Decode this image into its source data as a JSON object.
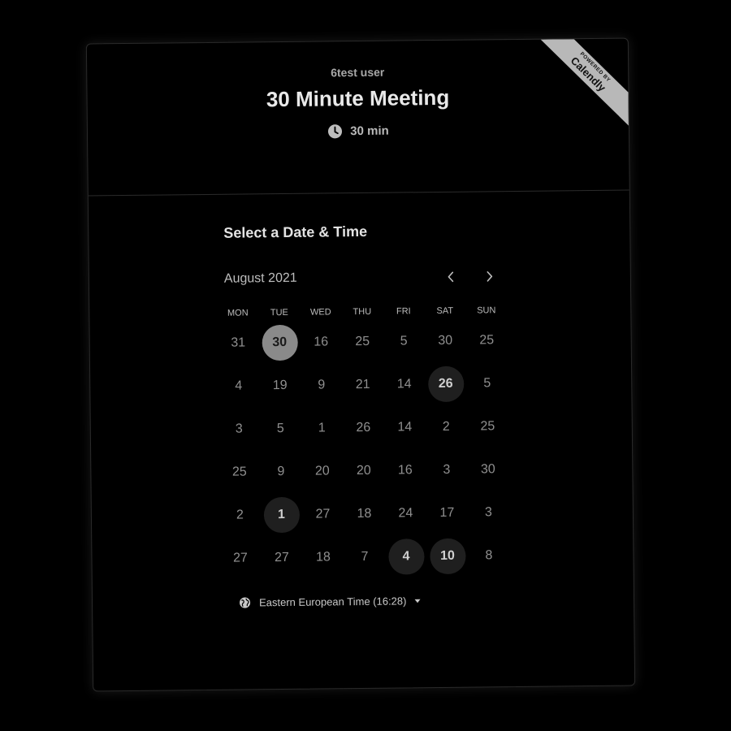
{
  "header": {
    "host_name": "6test user",
    "event_title": "30 Minute Meeting",
    "duration": "30 min"
  },
  "ribbon": {
    "small_text": "POWERED BY",
    "brand": "Calendly"
  },
  "picker": {
    "title": "Select a Date & Time",
    "month": "August 2021",
    "weekdays": [
      "MON",
      "TUE",
      "WED",
      "THU",
      "FRI",
      "SAT",
      "SUN"
    ],
    "weeks": [
      [
        "31",
        "30",
        "16",
        "25",
        "5",
        "30",
        "25"
      ],
      [
        "4",
        "19",
        "9",
        "21",
        "14",
        "26",
        "5"
      ],
      [
        "3",
        "5",
        "1",
        "26",
        "14",
        "2",
        "25"
      ],
      [
        "25",
        "9",
        "20",
        "20",
        "16",
        "3",
        "30"
      ],
      [
        "2",
        "1",
        "27",
        "18",
        "24",
        "17",
        "3"
      ],
      [
        "27",
        "27",
        "18",
        "7",
        "4",
        "10",
        "8"
      ]
    ]
  },
  "timezone": {
    "label": "Eastern European Time (16:28)"
  },
  "icons": {
    "clock": "clock-icon",
    "prev": "chevron-left-icon",
    "next": "chevron-right-icon",
    "globe": "globe-icon",
    "caret": "caret-down-icon"
  },
  "colors": {
    "background": "#000000",
    "selected_day": "#8a8a8a",
    "available_day": "#1f1f1f",
    "ribbon": "#b8b8b8"
  }
}
